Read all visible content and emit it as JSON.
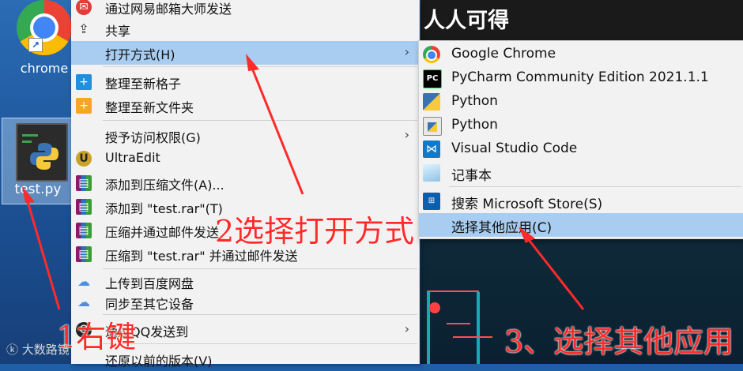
{
  "desktop": {
    "chrome_label": "chrome",
    "file_label": "test.py"
  },
  "background_window": {
    "title_fragment": "人人可得"
  },
  "context_menu": {
    "items": [
      {
        "label": "通过网易邮箱大师发送",
        "icon": "netease-mail-icon"
      },
      {
        "label": "共享",
        "icon": "share-icon"
      },
      {
        "label": "打开方式(H)",
        "icon": "",
        "submenu": true,
        "highlighted": true
      },
      {
        "label": "整理至新格子",
        "icon": "plus-blue-icon"
      },
      {
        "label": "整理至新文件夹",
        "icon": "plus-orange-icon"
      },
      {
        "label": "授予访问权限(G)",
        "icon": "",
        "submenu": true
      },
      {
        "label": "UltraEdit",
        "icon": "ultraedit-icon"
      },
      {
        "label": "添加到压缩文件(A)...",
        "icon": "winrar-icon"
      },
      {
        "label": "添加到 \"test.rar\"(T)",
        "icon": "winrar-icon"
      },
      {
        "label": "压缩并通过邮件发送",
        "icon": "winrar-icon"
      },
      {
        "label": "压缩到 \"test.rar\" 并通过邮件发送",
        "icon": "winrar-icon"
      },
      {
        "label": "上传到百度网盘",
        "icon": "baidu-netdisk-icon"
      },
      {
        "label": "同步至其它设备",
        "icon": "baidu-netdisk-icon"
      },
      {
        "label": "通过QQ发送到",
        "icon": "qq-icon",
        "submenu": true
      },
      {
        "label": "还原以前的版本(V)",
        "icon": ""
      }
    ]
  },
  "open_with_submenu": {
    "items": [
      {
        "label": "Google Chrome",
        "icon": "chrome-icon"
      },
      {
        "label": "PyCharm Community Edition 2021.1.1",
        "icon": "pycharm-icon"
      },
      {
        "label": "Python",
        "icon": "python-icon"
      },
      {
        "label": "Python",
        "icon": "python-idle-icon"
      },
      {
        "label": "Visual Studio Code",
        "icon": "vscode-icon"
      },
      {
        "label": "记事本",
        "icon": "notepad-icon"
      },
      {
        "label": "搜索 Microsoft Store(S)",
        "icon": "microsoft-store-icon"
      },
      {
        "label": "选择其他应用(C)",
        "icon": "",
        "highlighted": true
      }
    ]
  },
  "annotations": {
    "step1": "1右键",
    "step2": "2选择打开方式",
    "step3": "3、选择其他应用"
  },
  "watermark": "大数路镜",
  "colors": {
    "highlight": "#a8cdf0",
    "annotation_red": "#ff2a2a",
    "menu_bg": "#f2f2f2"
  }
}
